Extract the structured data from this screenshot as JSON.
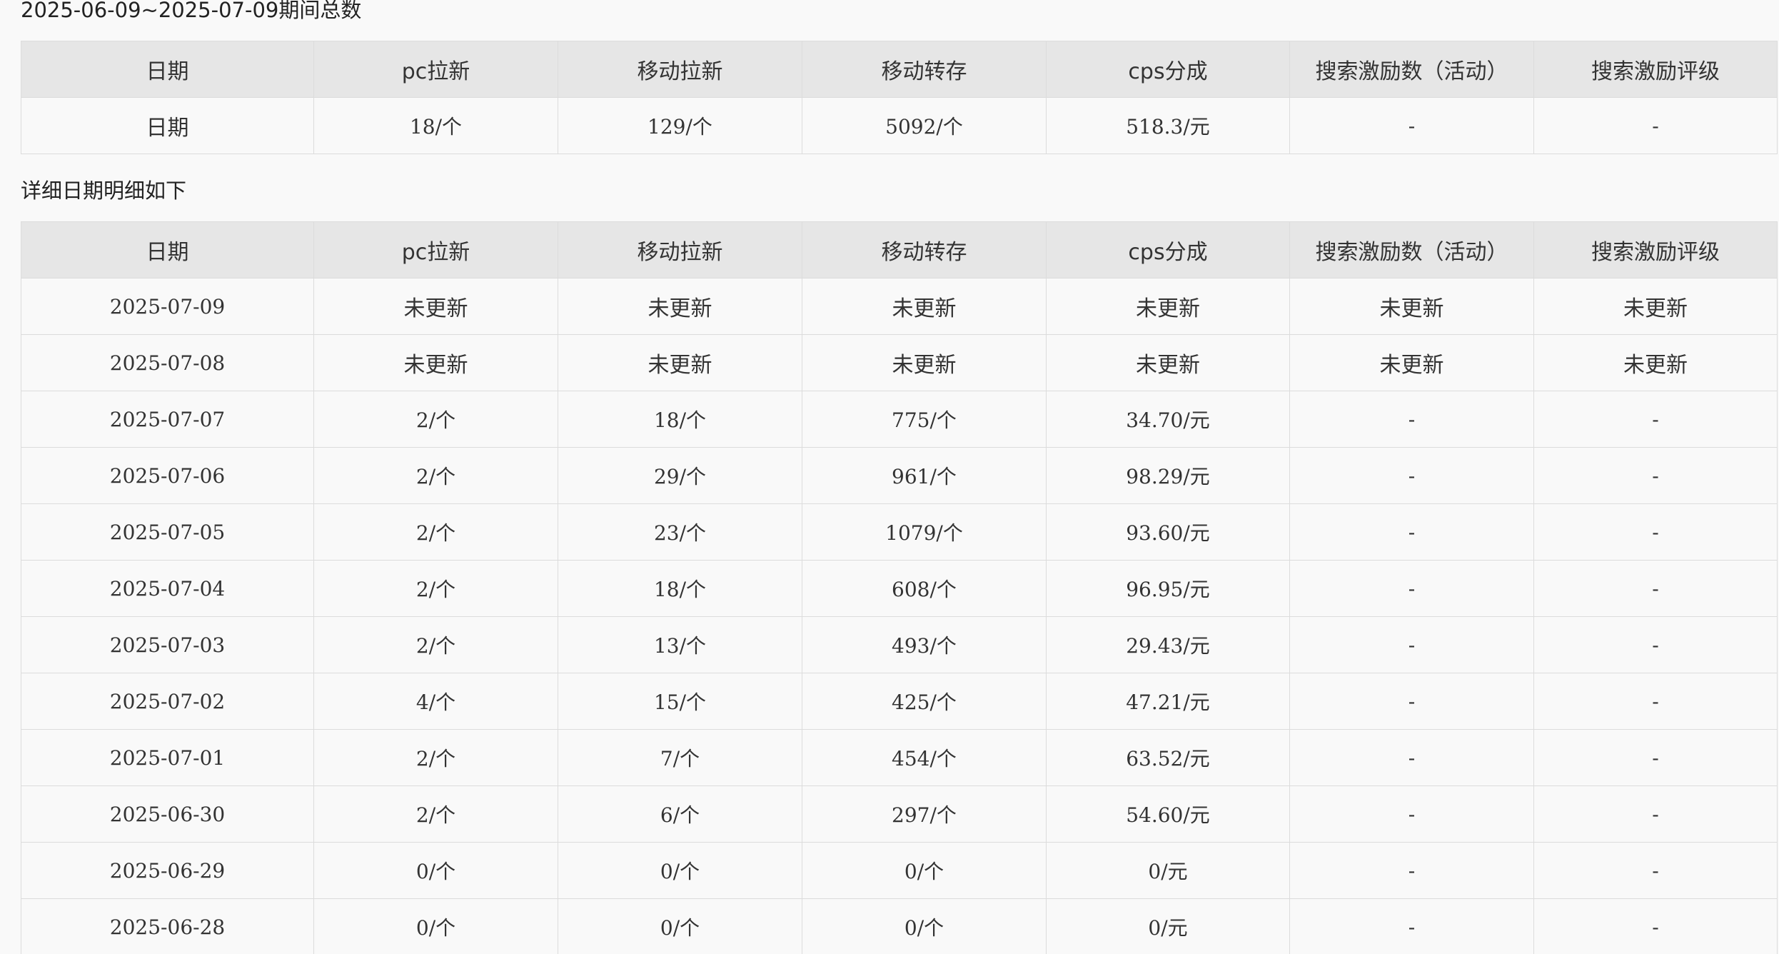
{
  "summary": {
    "title": "2025-06-09~2025-07-09期间总数",
    "headers": [
      "日期",
      "pc拉新",
      "移动拉新",
      "移动转存",
      "cps分成",
      "搜索激励数（活动）",
      "搜索激励评级"
    ],
    "row": [
      "日期",
      "18/个",
      "129/个",
      "5092/个",
      "518.3/元",
      "-",
      "-"
    ]
  },
  "detail": {
    "title": "详细日期明细如下",
    "headers": [
      "日期",
      "pc拉新",
      "移动拉新",
      "移动转存",
      "cps分成",
      "搜索激励数（活动）",
      "搜索激励评级"
    ],
    "rows": [
      [
        "2025-07-09",
        "未更新",
        "未更新",
        "未更新",
        "未更新",
        "未更新",
        "未更新"
      ],
      [
        "2025-07-08",
        "未更新",
        "未更新",
        "未更新",
        "未更新",
        "未更新",
        "未更新"
      ],
      [
        "2025-07-07",
        "2/个",
        "18/个",
        "775/个",
        "34.70/元",
        "-",
        "-"
      ],
      [
        "2025-07-06",
        "2/个",
        "29/个",
        "961/个",
        "98.29/元",
        "-",
        "-"
      ],
      [
        "2025-07-05",
        "2/个",
        "23/个",
        "1079/个",
        "93.60/元",
        "-",
        "-"
      ],
      [
        "2025-07-04",
        "2/个",
        "18/个",
        "608/个",
        "96.95/元",
        "-",
        "-"
      ],
      [
        "2025-07-03",
        "2/个",
        "13/个",
        "493/个",
        "29.43/元",
        "-",
        "-"
      ],
      [
        "2025-07-02",
        "4/个",
        "15/个",
        "425/个",
        "47.21/元",
        "-",
        "-"
      ],
      [
        "2025-07-01",
        "2/个",
        "7/个",
        "454/个",
        "63.52/元",
        "-",
        "-"
      ],
      [
        "2025-06-30",
        "2/个",
        "6/个",
        "297/个",
        "54.60/元",
        "-",
        "-"
      ],
      [
        "2025-06-29",
        "0/个",
        "0/个",
        "0/个",
        "0/元",
        "-",
        "-"
      ],
      [
        "2025-06-28",
        "0/个",
        "0/个",
        "0/个",
        "0/元",
        "-",
        "-"
      ]
    ]
  },
  "colors": {
    "header_background": "#e6e6e6",
    "page_background": "#f9f9f9",
    "border": "#dcdcdc",
    "text": "#333333"
  }
}
